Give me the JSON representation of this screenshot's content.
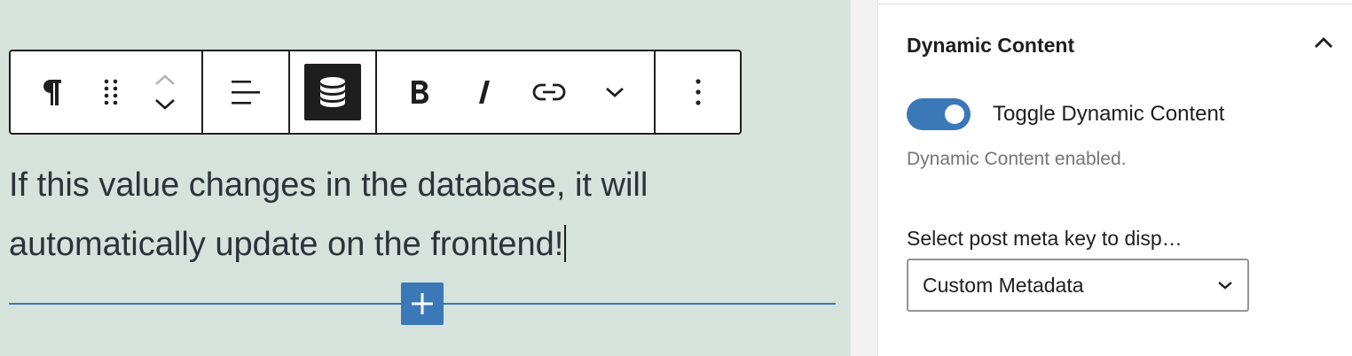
{
  "editor": {
    "paragraph_text": "If this value changes in the database, it will automatically update on the frontend!"
  },
  "toolbar": {
    "groups": [
      [
        "paragraph-icon",
        "drag-handle-icon",
        "move-up-down-icon"
      ],
      [
        "align-left-icon"
      ],
      [
        "database-icon"
      ],
      [
        "bold-icon",
        "italic-icon",
        "link-icon",
        "chevron-down-icon"
      ],
      [
        "more-options-icon"
      ]
    ],
    "active_button": "database-icon"
  },
  "sidebar": {
    "panel_title": "Dynamic Content",
    "toggle": {
      "label": "Toggle Dynamic Content",
      "checked": true
    },
    "help_text": "Dynamic Content enabled.",
    "select": {
      "label": "Select post meta key to disp…",
      "value": "Custom Metadata"
    }
  },
  "colors": {
    "canvas_bg": "#d5e3dc",
    "accent": "#3a78b8",
    "toolbar_border": "#1e1e1e",
    "text": "#2c3338",
    "muted_text": "#757575"
  }
}
